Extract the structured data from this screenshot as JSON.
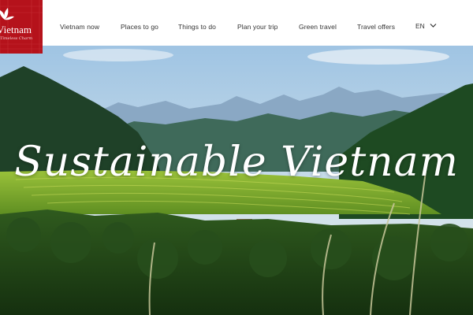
{
  "brand": {
    "name": "Vietnam",
    "tagline": "Timeless Charm",
    "color": "#b5121b"
  },
  "nav": {
    "items": [
      {
        "label": "Vietnam now"
      },
      {
        "label": "Places to go"
      },
      {
        "label": "Things to do"
      },
      {
        "label": "Plan your trip"
      },
      {
        "label": "Green travel"
      },
      {
        "label": "Travel offers"
      }
    ],
    "language": "EN",
    "language_icon": "chevron-down-icon"
  },
  "hero": {
    "title": "Sustainable Vietnam",
    "image": "terraced rice valley landscape"
  }
}
